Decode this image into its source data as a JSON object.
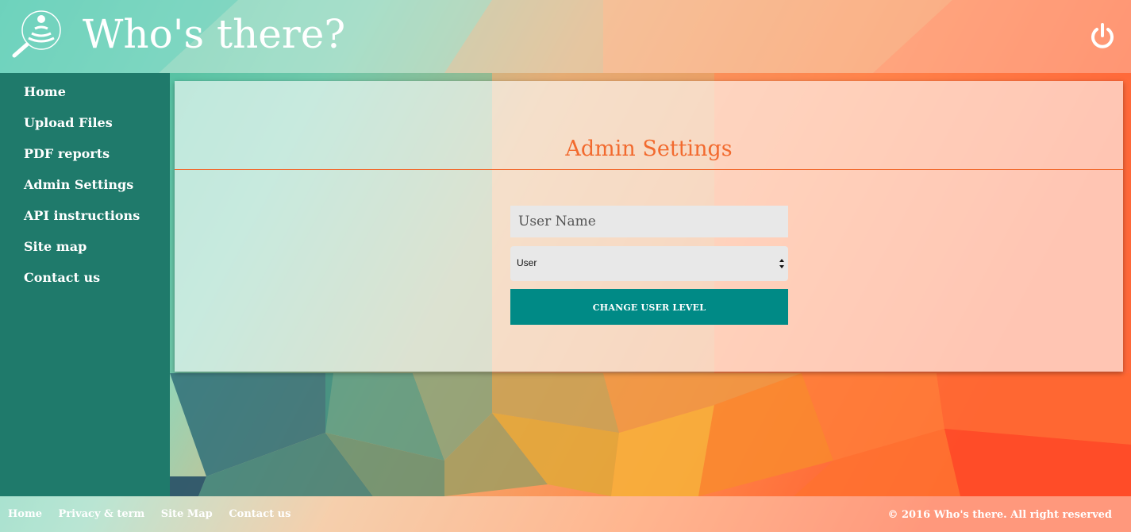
{
  "header": {
    "title": "Who's there?",
    "logo_icon": "magnifier-signal-icon",
    "logout_icon": "power-icon"
  },
  "sidebar": {
    "items": [
      {
        "label": "Home"
      },
      {
        "label": "Upload Files"
      },
      {
        "label": "PDF reports"
      },
      {
        "label": "Admin Settings"
      },
      {
        "label": "API instructions"
      },
      {
        "label": "Site map"
      },
      {
        "label": "Contact us"
      }
    ]
  },
  "main": {
    "title": "Admin Settings",
    "username_placeholder": "User Name",
    "username_value": "",
    "level_select": {
      "selected": "User"
    },
    "submit_label": "CHANGE USER LEVEL"
  },
  "footer": {
    "links": [
      {
        "label": "Home"
      },
      {
        "label": "Privacy & term"
      },
      {
        "label": "Site Map"
      },
      {
        "label": "Contact us"
      }
    ],
    "copyright": "© 2016 Who's there. All right reserved"
  },
  "colors": {
    "sidebar": "#1f7a6b",
    "accent": "#f26a2e",
    "button": "#008a86"
  }
}
